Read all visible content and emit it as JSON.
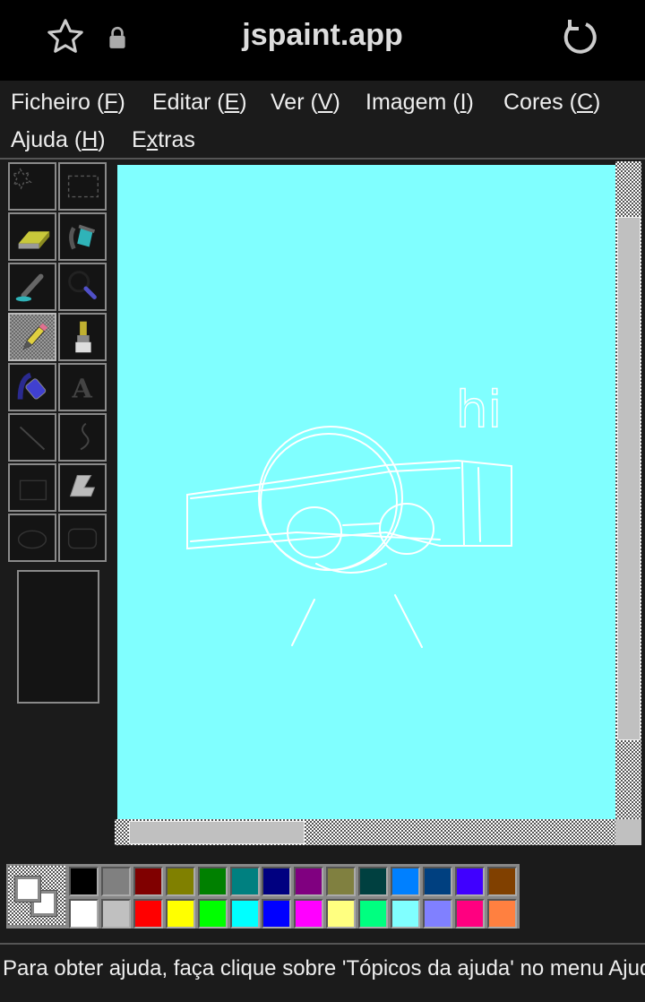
{
  "browser": {
    "title": "jspaint.app",
    "icons": [
      "star-icon",
      "lock-icon",
      "reload-icon"
    ]
  },
  "menu": [
    {
      "pre": "Ficheiro (",
      "key": "F",
      "post": ")"
    },
    {
      "pre": "Editar (",
      "key": "E",
      "post": ")"
    },
    {
      "pre": "Ver (",
      "key": "V",
      "post": ")"
    },
    {
      "pre": "Imagem (",
      "key": "I",
      "post": ")"
    },
    {
      "pre": "Cores (",
      "key": "C",
      "post": ")"
    },
    {
      "pre": "Ajuda (",
      "key": "H",
      "post": ")"
    },
    {
      "pre": "E",
      "key": "x",
      "post": "tras"
    }
  ],
  "tools": [
    "free-form-select",
    "select",
    "eraser",
    "fill",
    "pick-color",
    "magnifier",
    "pencil",
    "brush",
    "airbrush",
    "text",
    "line",
    "curve",
    "rectangle",
    "polygon",
    "ellipse",
    "rounded-rectangle"
  ],
  "selected_tool": "pencil",
  "canvas": {
    "background": "#80ffff",
    "text": "hi"
  },
  "colors": {
    "foreground": "#ffffff",
    "background": "#ffffff"
  },
  "palette": [
    "#000000",
    "#808080",
    "#800000",
    "#808000",
    "#008000",
    "#008080",
    "#000080",
    "#800080",
    "#808040",
    "#004040",
    "#0080ff",
    "#004080",
    "#4000ff",
    "#804000",
    "#ffffff",
    "#c0c0c0",
    "#ff0000",
    "#ffff00",
    "#00ff00",
    "#00ffff",
    "#0000ff",
    "#ff00ff",
    "#ffff80",
    "#00ff80",
    "#80ffff",
    "#8080ff",
    "#ff0080",
    "#ff8040"
  ],
  "status": "Para obter ajuda, faça clique sobre 'Tópicos da ajuda' no menu Ajuda."
}
